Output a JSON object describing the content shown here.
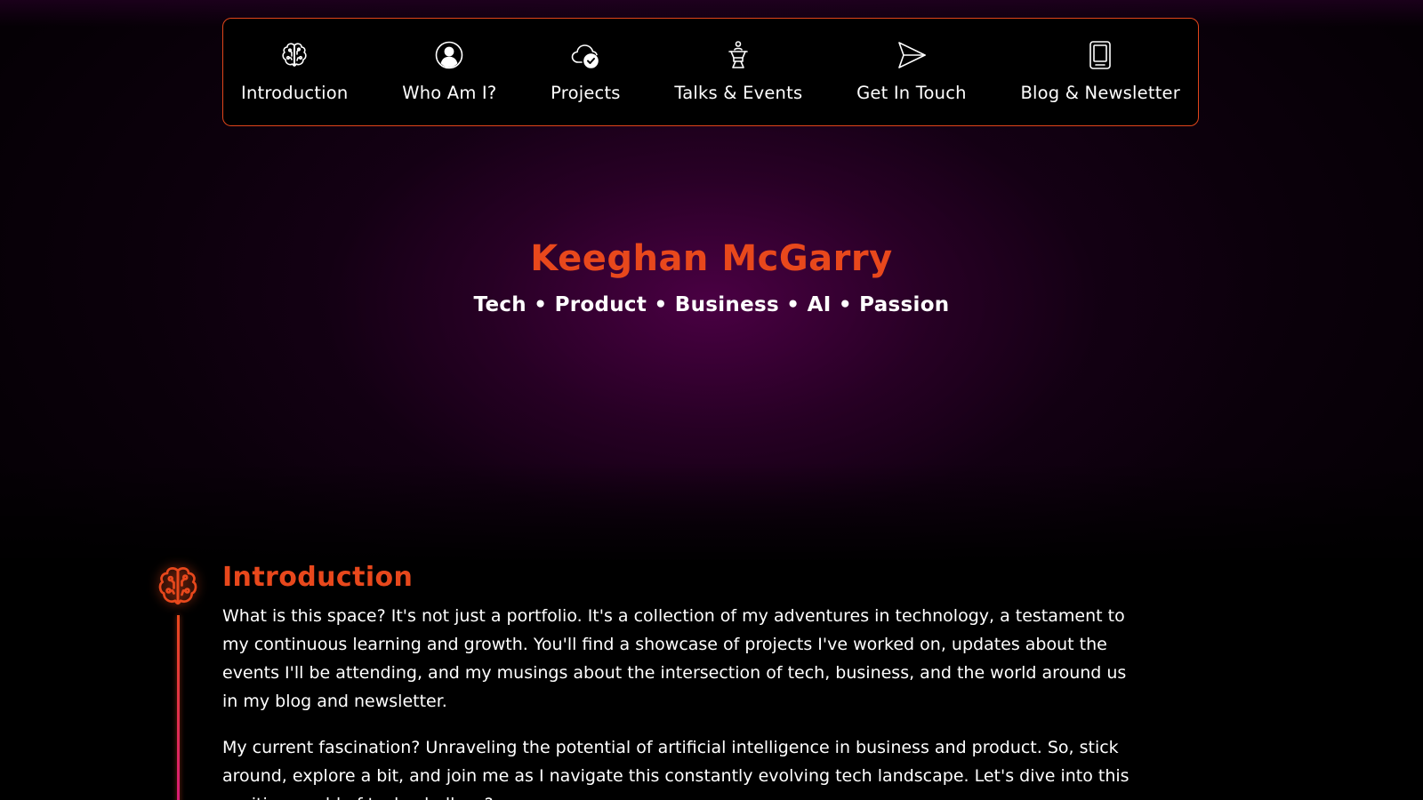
{
  "nav": {
    "items": [
      {
        "label": "Introduction",
        "icon": "brain-icon"
      },
      {
        "label": "Who Am I?",
        "icon": "user-circle-icon"
      },
      {
        "label": "Projects",
        "icon": "cloud-check-icon"
      },
      {
        "label": "Talks & Events",
        "icon": "podium-speaker-icon"
      },
      {
        "label": "Get In Touch",
        "icon": "send-icon"
      },
      {
        "label": "Blog & Newsletter",
        "icon": "book-icon"
      }
    ]
  },
  "hero": {
    "name": "Keeghan McGarry",
    "tagline": "Tech • Product • Business • AI • Passion"
  },
  "intro": {
    "icon": "brain-icon",
    "title": "Introduction",
    "paragraphs": [
      "What is this space? It's not just a portfolio. It's a collection of my adventures in technology, a testament to my continuous learning and growth. You'll find a showcase of projects I've worked on, updates about the events I'll be attending, and my musings about the intersection of tech, business, and the world around us in my blog and newsletter.",
      "My current fascination? Unraveling the potential of artificial intelligence in business and product. So, stick around, explore a bit, and join me as I navigate this constantly evolving tech landscape. Let's dive into this exciting world of tech, shall we?"
    ]
  },
  "colors": {
    "accent": "#e8481c",
    "timeline_end": "#d8197a",
    "background": "#000000",
    "hero_glow": "#5f0055"
  }
}
